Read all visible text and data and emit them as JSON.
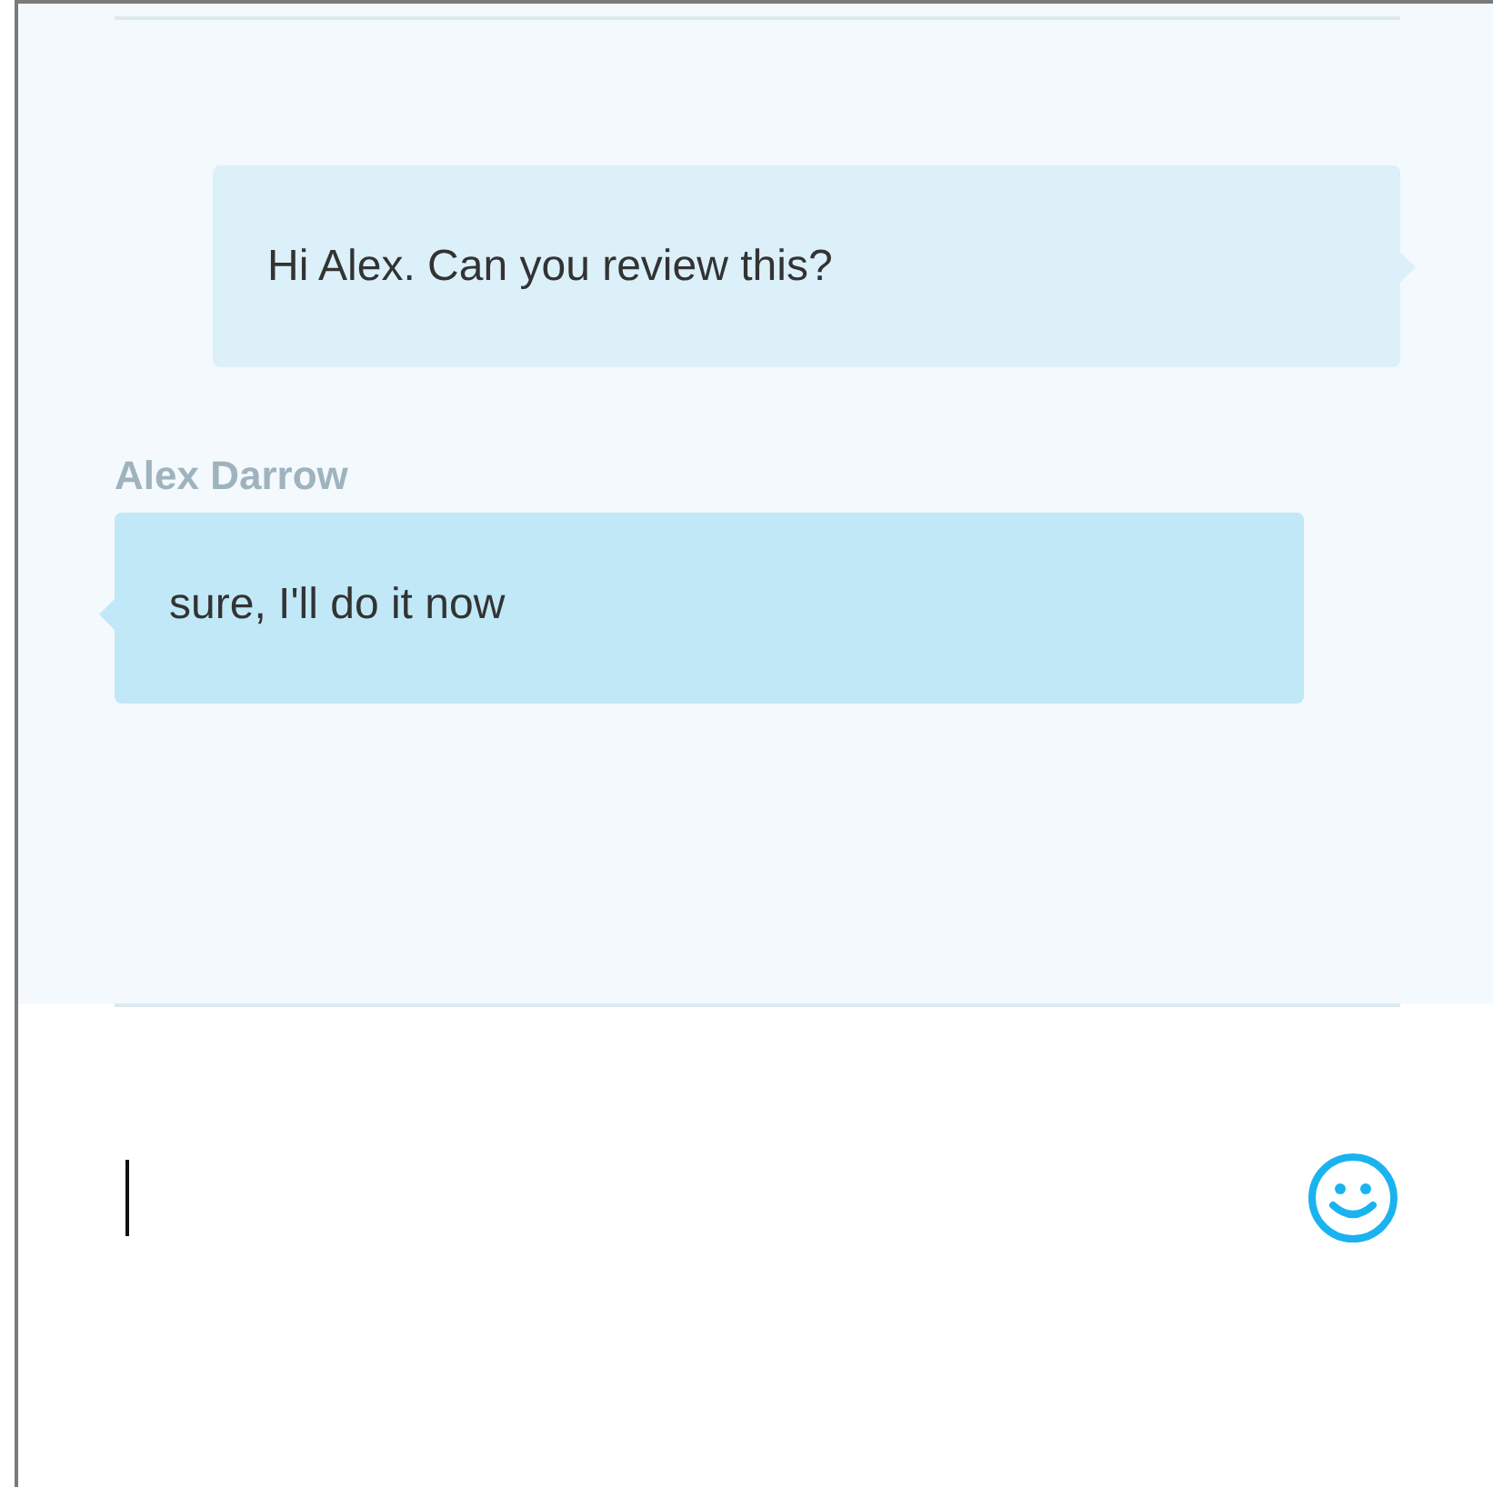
{
  "messages": [
    {
      "kind": "outgoing",
      "text": "Hi Alex. Can you review this?"
    },
    {
      "kind": "incoming",
      "sender": "Alex Darrow",
      "text": "sure, I'll do it now"
    }
  ],
  "composer": {
    "focused": true
  }
}
